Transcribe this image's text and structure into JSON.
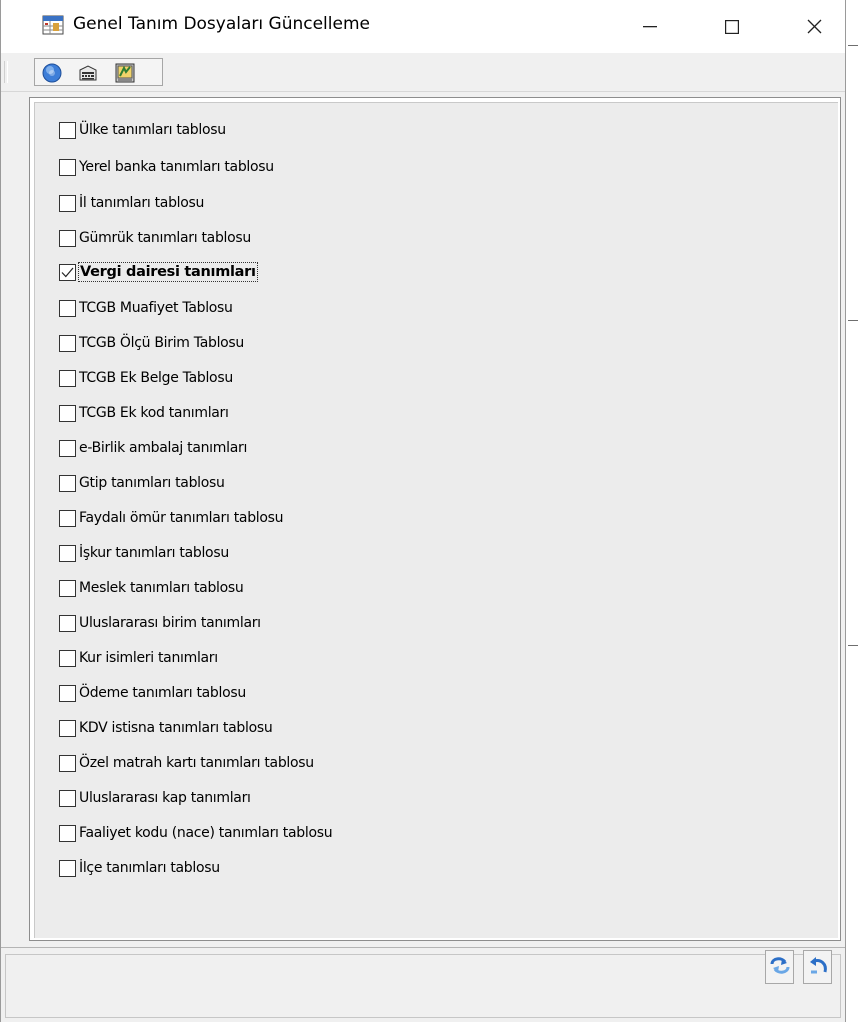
{
  "window": {
    "title": "Genel Tanım Dosyaları Güncelleme",
    "icon": "app-table-icon",
    "controls": [
      "minimize-icon",
      "maximize-icon",
      "close-icon"
    ]
  },
  "toolbar": {
    "buttons": [
      {
        "icon": "help-icon"
      },
      {
        "icon": "calculator-icon"
      },
      {
        "icon": "tools-icon"
      }
    ]
  },
  "checklist": {
    "items": [
      {
        "label": "Ülke tanımları tablosu",
        "checked": false
      },
      {
        "label": "Yerel banka tanımları tablosu",
        "checked": false
      },
      {
        "label": "İl tanımları tablosu",
        "checked": false
      },
      {
        "label": "Gümrük tanımları tablosu",
        "checked": false
      },
      {
        "label": "Vergi dairesi tanımları",
        "checked": true
      },
      {
        "label": "TCGB Muafiyet Tablosu",
        "checked": false
      },
      {
        "label": "TCGB Ölçü Birim Tablosu",
        "checked": false
      },
      {
        "label": "TCGB Ek Belge Tablosu",
        "checked": false
      },
      {
        "label": "TCGB Ek kod tanımları",
        "checked": false
      },
      {
        "label": "e-Birlik ambalaj tanımları",
        "checked": false
      },
      {
        "label": "Gtip tanımları tablosu",
        "checked": false
      },
      {
        "label": "Faydalı ömür tanımları tablosu",
        "checked": false
      },
      {
        "label": "İşkur tanımları tablosu",
        "checked": false
      },
      {
        "label": "Meslek tanımları tablosu",
        "checked": false
      },
      {
        "label": "Uluslararası birim tanımları",
        "checked": false
      },
      {
        "label": "Kur isimleri tanımları",
        "checked": false
      },
      {
        "label": "Ödeme tanımları tablosu",
        "checked": false
      },
      {
        "label": "KDV istisna tanımları tablosu",
        "checked": false
      },
      {
        "label": "Özel matrah kartı tanımları tablosu",
        "checked": false
      },
      {
        "label": "Uluslararası kap tanımları",
        "checked": false
      },
      {
        "label": "Faaliyet kodu (nace) tanımları tablosu",
        "checked": false
      },
      {
        "label": "İlçe tanımları tablosu",
        "checked": false
      }
    ]
  },
  "actions": [
    {
      "icon": "update-icon"
    },
    {
      "icon": "undo-icon"
    }
  ],
  "colors": {
    "window_bg": "#f0f0f0",
    "panel_bg": "#ececec",
    "titlebar_bg": "#ffffff"
  }
}
